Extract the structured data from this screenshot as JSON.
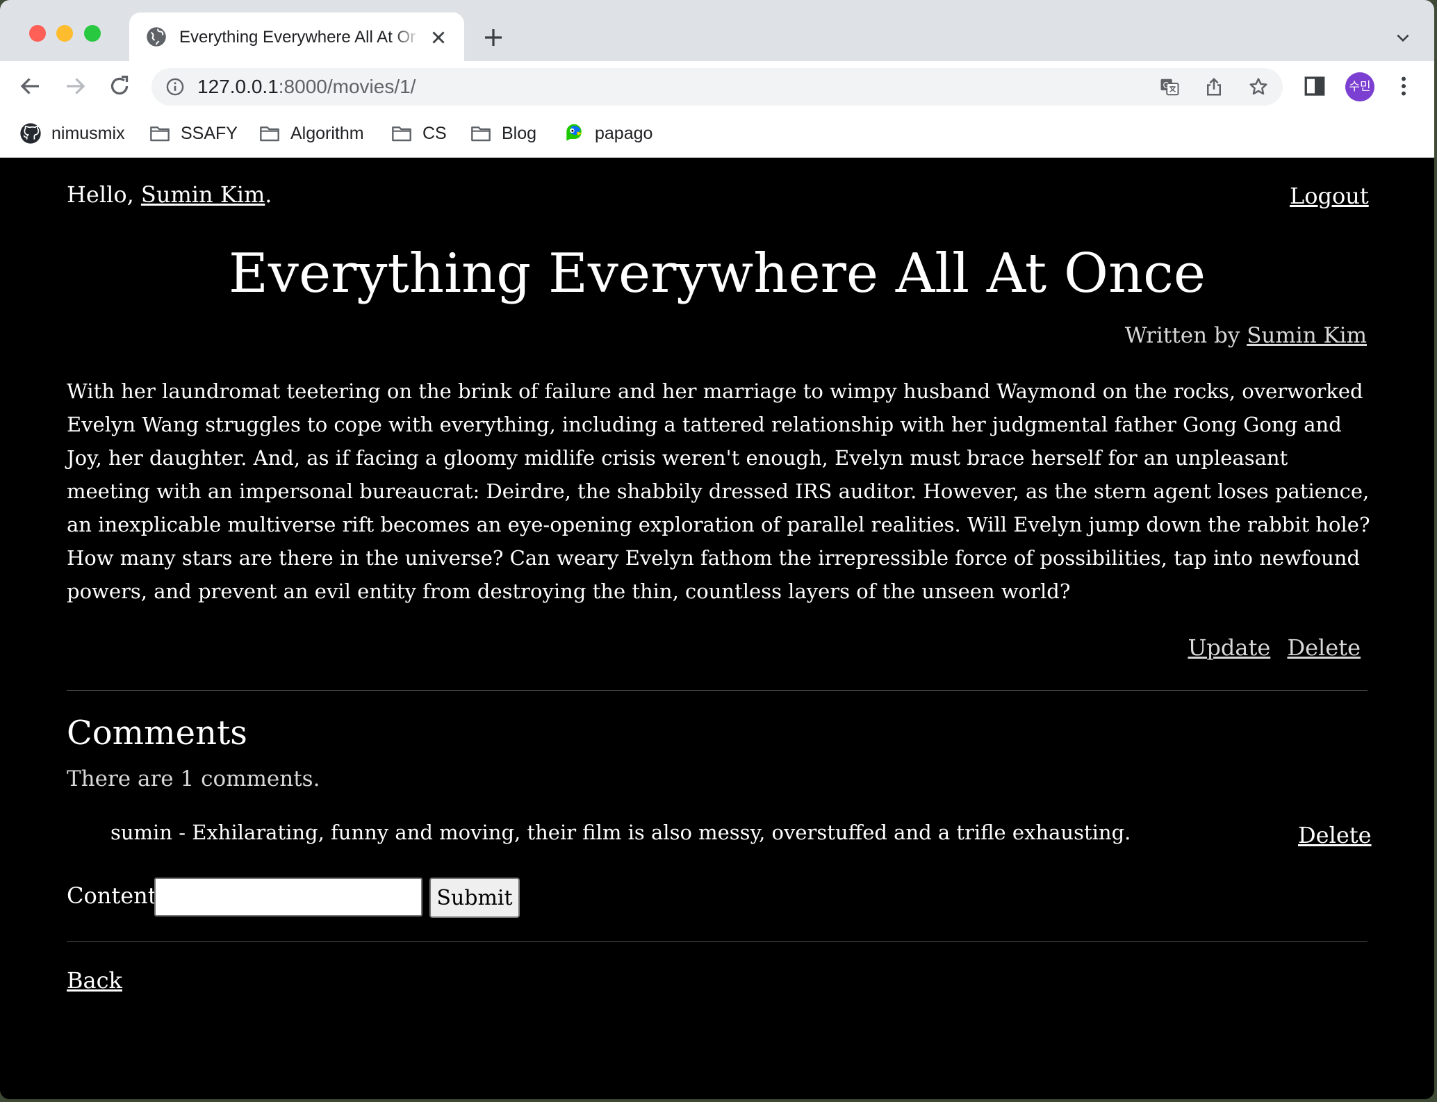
{
  "browser": {
    "tab_title": "Everything Everywhere All At Once",
    "url_host": "127.0.0.1",
    "url_rest": ":8000/movies/1/",
    "avatar_label": "수민",
    "bookmarks": [
      {
        "label": "nimusmix",
        "icon": "github-icon"
      },
      {
        "label": "SSAFY",
        "icon": "folder-icon"
      },
      {
        "label": "Algorithm",
        "icon": "folder-icon"
      },
      {
        "label": "CS",
        "icon": "folder-icon"
      },
      {
        "label": "Blog",
        "icon": "folder-icon"
      },
      {
        "label": "papago",
        "icon": "papago-icon"
      }
    ]
  },
  "page": {
    "greeting_prefix": "Hello, ",
    "user_name": "Sumin Kim",
    "greeting_suffix": ".",
    "logout_label": "Logout",
    "movie_title": "Everything Everywhere All At Once",
    "written_by_label": "Written by ",
    "author": "Sumin Kim",
    "description": "With her laundromat teetering on the brink of failure and her marriage to wimpy husband Waymond on the rocks, overworked Evelyn Wang struggles to cope with everything, including a tattered relationship with her judgmental father Gong Gong and Joy, her daughter. And, as if facing a gloomy midlife crisis weren't enough, Evelyn must brace herself for an unpleasant meeting with an impersonal bureaucrat: Deirdre, the shabbily dressed IRS auditor. However, as the stern agent loses patience, an inexplicable multiverse rift becomes an eye-opening exploration of parallel realities. Will Evelyn jump down the rabbit hole? How many stars are there in the universe? Can weary Evelyn fathom the irrepressible force of possibilities, tap into newfound powers, and prevent an evil entity from destroying the thin, countless layers of the unseen world?",
    "update_label": "Update",
    "delete_label": "Delete",
    "comments_heading": "Comments",
    "comment_count_text": "There are 1 comments.",
    "comments": [
      {
        "text": "sumin - Exhilarating, funny and moving, their film is also messy, overstuffed and a trifle exhausting.",
        "delete_label": "Delete"
      }
    ],
    "form": {
      "content_label": "Content:",
      "content_value": "",
      "submit_label": "Submit"
    },
    "back_label": "Back"
  }
}
